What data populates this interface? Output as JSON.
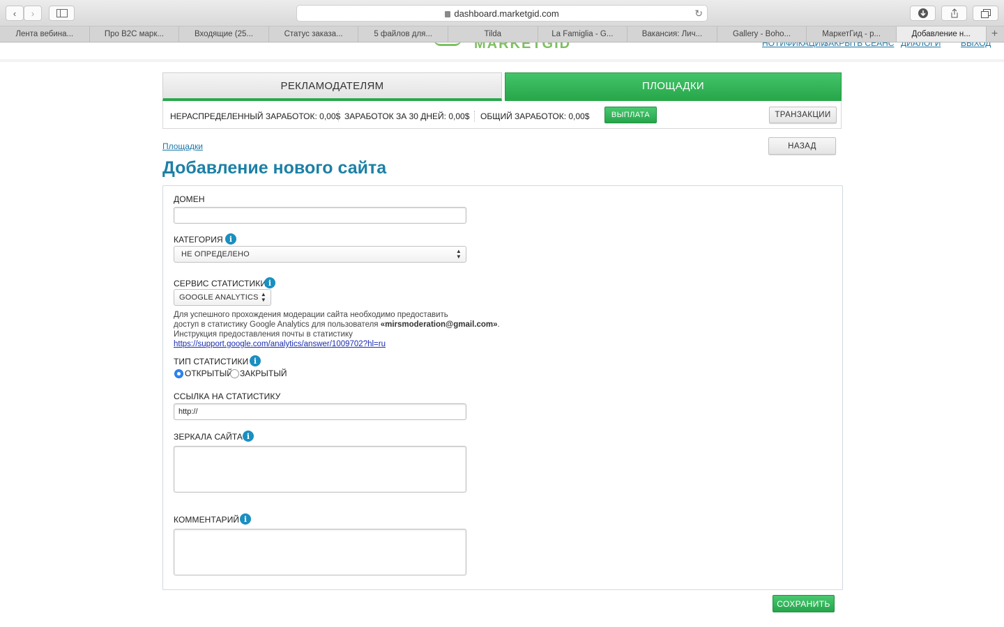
{
  "browser": {
    "url": "dashboard.marketgid.com",
    "tabs": [
      "Лента вебина...",
      "Про B2C марк...",
      "Входящие (25...",
      "Статус заказа...",
      "5 файлов для...",
      "Tilda",
      "La Famiglia - G...",
      "Вакансия: Лич...",
      "Gallery - Boho...",
      "МаркетГид - р...",
      "Добавление н..."
    ],
    "active_tab_index": 10
  },
  "header": {
    "top_links": [
      "НОТИФИКАЦИИ",
      "ЗАКРЫТЬ СЕАНС",
      "ДИАЛОГИ",
      "ВЫХОД"
    ]
  },
  "main_tabs": {
    "advertisers": "РЕКЛАМОДАТЕЛЯМ",
    "platforms": "ПЛОЩАДКИ"
  },
  "earnings": {
    "undistributed_label": "НЕРАСПРЕДЕЛЕННЫЙ ЗАРАБОТОК:",
    "undistributed_value": "0,00$",
    "last30_label": "ЗАРАБОТОК ЗА 30 ДНЕЙ:",
    "last30_value": "0,00$",
    "total_label": "ОБЩИЙ ЗАРАБОТОК:",
    "total_value": "0,00$",
    "payout_button": "ВЫПЛАТА",
    "transactions_button": "ТРАНЗАКЦИИ"
  },
  "breadcrumb": "Площадки",
  "back_button": "НАЗАД",
  "page_title": "Добавление нового сайта",
  "form": {
    "domain_label": "ДОМЕН",
    "domain_value": "",
    "category_label": "КАТЕГОРИЯ",
    "category_value": "НЕ ОПРЕДЕЛЕНО",
    "stats_service_label": "СЕРВИС СТАТИСТИКИ",
    "stats_service_value": "GOOGLE ANALYTICS",
    "note_line1": "Для успешного прохождения модерации сайта необходимо предоставить",
    "note_line2_prefix": "доступ в статистику Google Analytics для пользователя ",
    "note_email": "«mirsmoderation@gmail.com»",
    "note_line2_suffix": ".",
    "note_line3": "Инструкция предоставления почты в статистику",
    "note_link": "https://support.google.com/analytics/answer/1009702?hl=ru",
    "stats_type_label": "ТИП СТАТИСТИКИ",
    "stats_type_open": "ОТКРЫТЫЙ",
    "stats_type_closed": "ЗАКРЫТЫЙ",
    "stats_type_selected": "open",
    "stats_link_label": "ССЫЛКА НА СТАТИСТИКУ",
    "stats_link_value": "http://",
    "mirrors_label": "ЗЕРКАЛА САЙТА",
    "comment_label": "КОММЕНТАРИЙ",
    "save_button": "СОХРАНИТЬ"
  },
  "colors": {
    "accent_green": "#2aa84c",
    "title_blue": "#1c80a6",
    "info_blue": "#1a8fc0",
    "link_blue": "#1a77a8"
  }
}
